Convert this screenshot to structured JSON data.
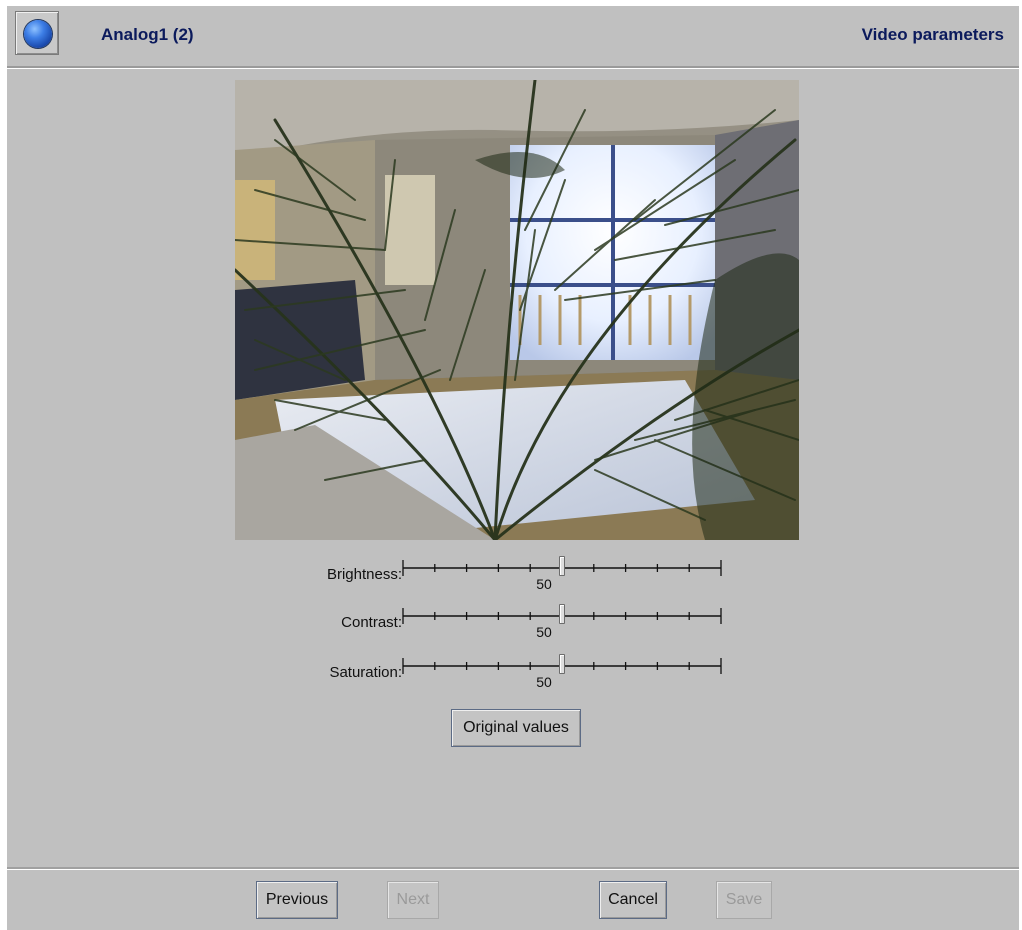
{
  "header": {
    "device_name": "Analog1 (2)",
    "page_title": "Video parameters",
    "status_icon": "blue-sphere-icon"
  },
  "preview": {
    "description_icon": "camera-preview-image"
  },
  "sliders": [
    {
      "label": "Brightness:",
      "value": "50",
      "level": 50,
      "min": 0,
      "max": 100
    },
    {
      "label": "Contrast:",
      "value": "50",
      "level": 50,
      "min": 0,
      "max": 100
    },
    {
      "label": "Saturation:",
      "value": "50",
      "level": 50,
      "min": 0,
      "max": 100
    }
  ],
  "original_values_label": "Original values",
  "footer": {
    "previous_label": "Previous",
    "next_label": "Next",
    "cancel_label": "Cancel",
    "save_label": "Save",
    "next_enabled": false,
    "save_enabled": false
  },
  "colors": {
    "background": "#c0c0c0",
    "title_text": "#0b1a5c"
  }
}
